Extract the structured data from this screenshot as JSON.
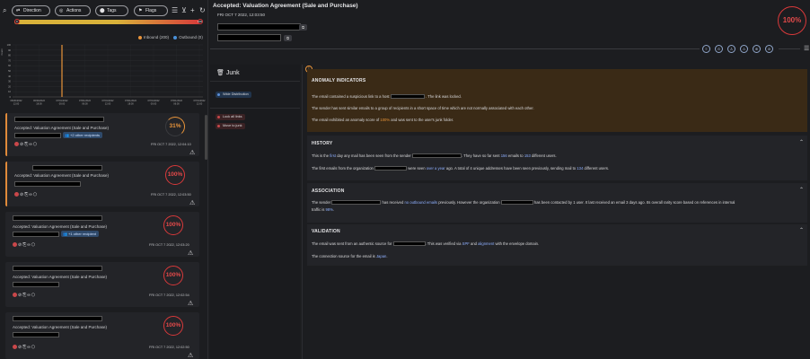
{
  "filters": {
    "pills": [
      {
        "label": "Direction",
        "icon": "⇄"
      },
      {
        "label": "Actions",
        "icon": "◎"
      },
      {
        "label": "Tags",
        "icon": "⬤"
      },
      {
        "label": "Flags",
        "icon": "⚑"
      }
    ]
  },
  "risk_filter": {
    "min": 0,
    "max": 100,
    "min_label": "0",
    "max_label": "100"
  },
  "traffic_chart": {
    "legend": [
      {
        "name": "Inbound (200)",
        "color": "#e8943a"
      },
      {
        "name": "Outbound (0)",
        "color": "#4a90d9"
      }
    ],
    "ylabel": "Count",
    "yticks": [
      0,
      10,
      20,
      30,
      40,
      50,
      60,
      70,
      80,
      90,
      100
    ],
    "xticks": [
      "06/30/2022 12:00",
      "06/30/2022 18:00",
      "07/01/2022 00:00",
      "07/01/2022 06:00",
      "07/01/2022 12:00",
      "07/01/2022 18:00",
      "07/01/2022 00:00",
      "07/01/2022 06:00",
      "07/01/2022 12:00"
    ]
  },
  "chart_data": {
    "type": "bar",
    "title": "",
    "xlabel": "",
    "ylabel": "Count",
    "ylim": [
      0,
      100
    ],
    "series": [
      {
        "name": "Inbound (200)",
        "color": "#e8943a",
        "x": [
          "07/01/2022 00:00"
        ],
        "values": [
          100
        ]
      },
      {
        "name": "Outbound (0)",
        "color": "#4a90d9",
        "x": [],
        "values": []
      }
    ],
    "legend_position": "top-right",
    "grid": true
  },
  "emails": [
    {
      "subject": "Accepted: Valuation Agreement (Sale and Purchase)",
      "tag": "+2 other recipients",
      "score": "31%",
      "date": "FRI OCT 7 2022, 12:04:10"
    },
    {
      "subject": "Accepted: Valuation Agreement (Sale and Purchase)",
      "tag": "",
      "score": "100%",
      "date": "FRI OCT 7 2022, 12:03:50"
    },
    {
      "subject": "Accepted: Valuation Agreement (Sale and Purchase)",
      "tag": "+1 other recipient",
      "score": "100%",
      "date": "FRI OCT 7 2022, 12:03:20"
    },
    {
      "subject": "Accepted: Valuation Agreement (Sale and Purchase)",
      "tag": "",
      "score": "100%",
      "date": "FRI OCT 7 2022, 12:02:54"
    },
    {
      "subject": "Accepted: Valuation Agreement (Sale and Purchase)",
      "tag": "",
      "score": "100%",
      "date": "FRI OCT 7 2022, 12:02:50"
    }
  ],
  "detail": {
    "title": "Accepted: Valuation Agreement (Sale and Purchase)",
    "date": "FRI OCT 7 2022, 12:03:50",
    "score": "100%",
    "action_icons": [
      "≡",
      "⊙",
      "♙",
      "⚠",
      "⊕",
      "⊘"
    ]
  },
  "folder": {
    "name": "Junk",
    "tags": [
      "Wide Distribution"
    ],
    "actions": [
      "Lock all links",
      "Move to junk"
    ]
  },
  "sections": {
    "anomaly": {
      "title": "ANOMALY INDICATORS",
      "l1a": "The email contained a suspicious link to a host",
      "l1b": ". The link was locked.",
      "l2": "The sender has sent similar emails to a group of recipients in a short space of time which are not normally associated with each other.",
      "l3a": "The email exhibited an anomaly score of",
      "l3pct": "100%",
      "l3b": "and was sent to the user's junk folder."
    },
    "history": {
      "title": "HISTORY",
      "l1a": "This is the",
      "l1first": "first",
      "l1b": "day any mail has been seen from the sender",
      "l1c": ". They have so far sent",
      "l1n1": "156",
      "l1d": "emails to",
      "l1n2": "153",
      "l1e": "different users.",
      "l2a": "The first emails from the organization",
      "l2b": "were seen",
      "l2ago": "over a year",
      "l2c": "ago. A total of 4 unique addresses have been seen previously, sending mail to",
      "l2n": "134",
      "l2d": "different users."
    },
    "association": {
      "title": "ASSOCIATION",
      "l1a": "The sender",
      "l1b": "has received",
      "l1no": "no outbound emails",
      "l1c": "previously. However the organization",
      "l1d": "has been contacted by 1 user. It last received an email 3 days ago. Its overall rarity score based on references in internal",
      "l2a": "traffic is",
      "l2pct": "98%",
      "l2b": "."
    },
    "validation": {
      "title": "VALIDATION",
      "l1a": "The email was sent from an authentic source for",
      "l1b": ". This was verified via",
      "l1spf": "SPF",
      "l1c": "and",
      "l1align": "alignment",
      "l1d": "with the envelope domain.",
      "l2a": "The connection source for the email is",
      "l2country": "Japan",
      "l2b": "."
    }
  }
}
